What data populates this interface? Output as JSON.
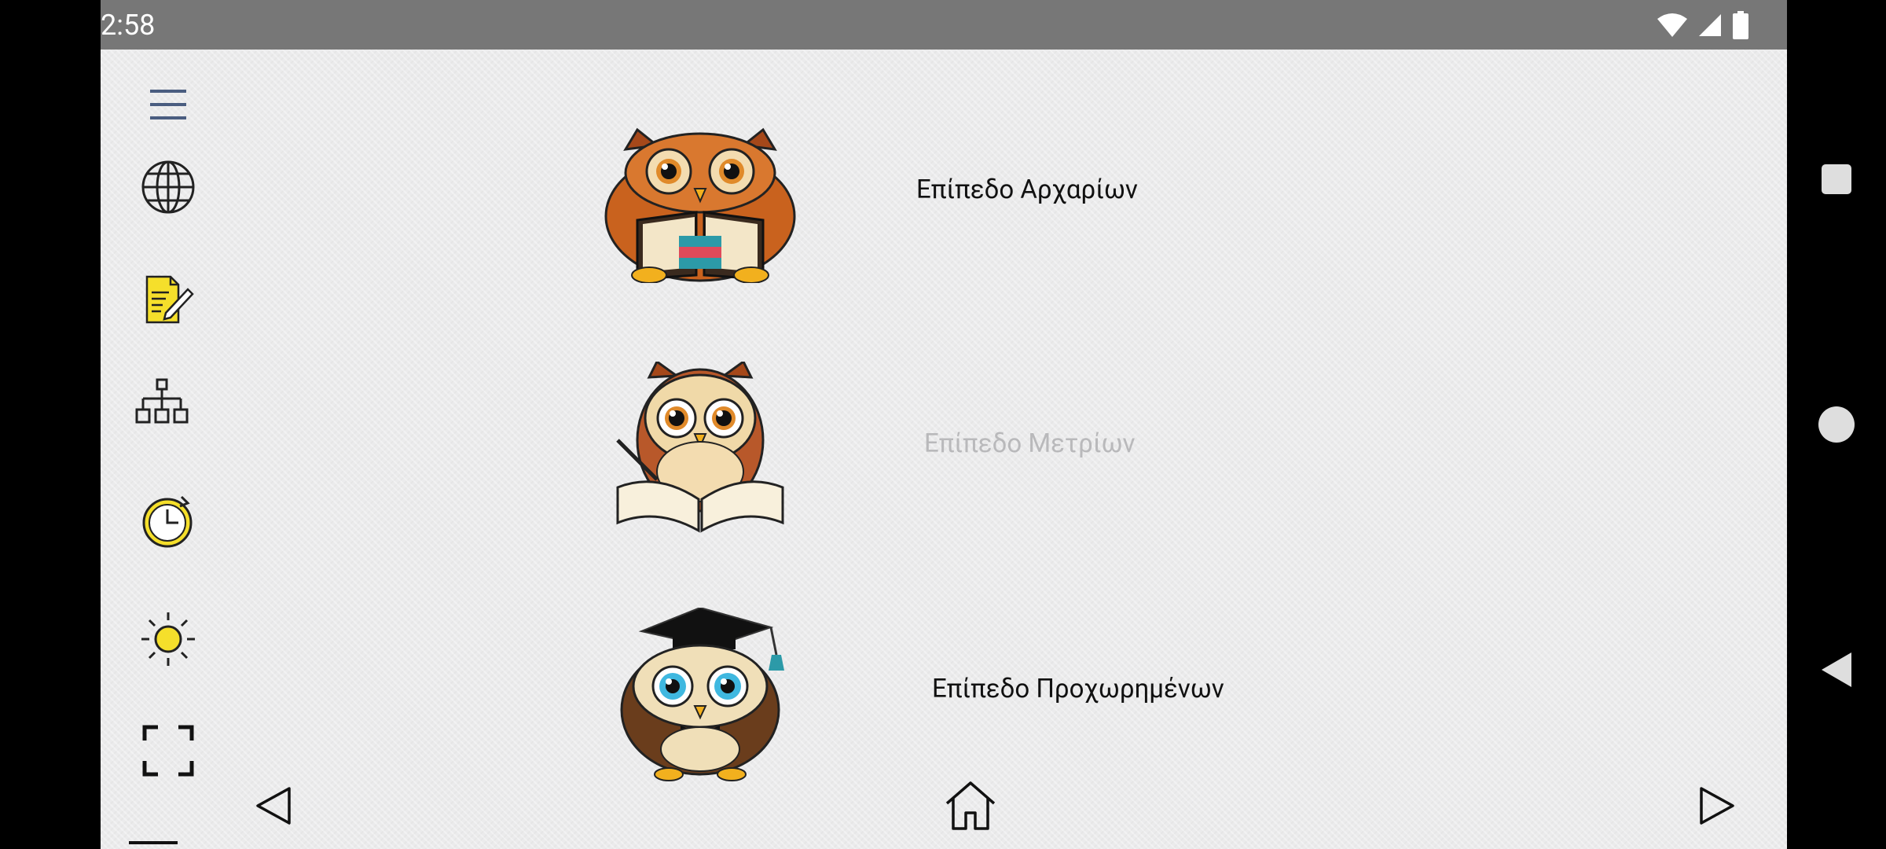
{
  "status_bar": {
    "time": "2:58"
  },
  "sidebar": {
    "items": [
      {
        "name": "menu"
      },
      {
        "name": "language"
      },
      {
        "name": "notes"
      },
      {
        "name": "hierarchy"
      },
      {
        "name": "history"
      },
      {
        "name": "brightness"
      },
      {
        "name": "fullscreen"
      }
    ]
  },
  "levels": [
    {
      "label": "Επίπεδο Αρχαρίων",
      "enabled": true
    },
    {
      "label": "Επίπεδο Μετρίων",
      "enabled": false
    },
    {
      "label": "Επίπεδο Προχωρημένων",
      "enabled": true
    }
  ],
  "bottom_nav": {
    "items": [
      "previous",
      "home",
      "next"
    ]
  },
  "colors": {
    "status_bar": "#777777",
    "background": "#ebebec",
    "icon_blue_gray": "#4a5d80",
    "icon_yellow": "#f5df2b",
    "label_text": "#111111",
    "label_disabled": "#b9b9bb"
  }
}
